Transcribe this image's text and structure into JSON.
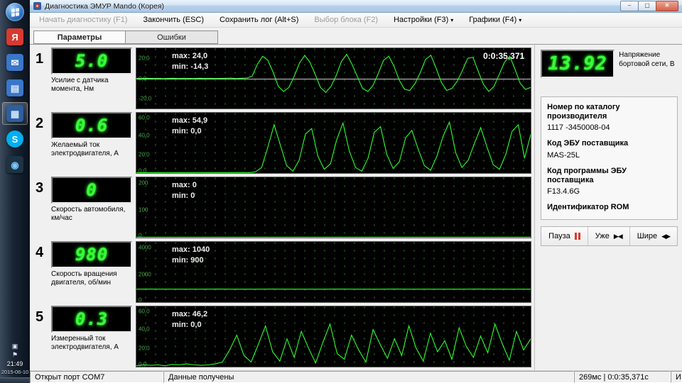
{
  "colors": {
    "trace": "#2eff2e",
    "led_green": "#39ff39",
    "grid_dot": "#1c451c",
    "pause_red": "#e0362c",
    "aero_blue": "#aac7e5"
  },
  "taskbar": {
    "clock_time": "21:49",
    "clock_date": "2015-06-10",
    "icons": [
      {
        "name": "yandex-browser",
        "glyph": "Я",
        "bg": "#d63a30",
        "fg": "#ffffff"
      },
      {
        "name": "mail-app",
        "glyph": "✉",
        "bg": "#3a76c9",
        "fg": "#ffffff"
      },
      {
        "name": "disk-app",
        "glyph": "▤",
        "bg": "#3a76c9",
        "fg": "#dce8f8"
      },
      {
        "name": "diagnostics-app",
        "glyph": "▦",
        "bg": "#2d5f9f",
        "fg": "#cfe3ff",
        "active": true
      },
      {
        "name": "skype",
        "glyph": "S",
        "bg": "#00aff0",
        "fg": "#ffffff",
        "round": true
      },
      {
        "name": "browser-globe",
        "glyph": "◉",
        "bg": "#1d3344",
        "fg": "#7fc7ff"
      }
    ]
  },
  "window": {
    "title": "Диагностика ЭМУР Mando (Корея)",
    "caption_buttons": [
      {
        "name": "minimize-button",
        "glyph": "–"
      },
      {
        "name": "maximize-button",
        "glyph": "▢"
      },
      {
        "name": "close-button",
        "glyph": "✕",
        "close": true
      }
    ],
    "menu": [
      {
        "id": "start-diagnostics",
        "label": "Начать диагностику (F1)",
        "disabled": true
      },
      {
        "id": "finish",
        "label": "Закончить (ESC)"
      },
      {
        "id": "save-log",
        "label": "Сохранить лог (Alt+S)"
      },
      {
        "id": "select-block",
        "label": "Выбор блока (F2)",
        "disabled": true
      },
      {
        "id": "settings",
        "label": "Настройки (F3)",
        "caret": true
      },
      {
        "id": "graphs",
        "label": "Графики (F4)",
        "caret": true
      }
    ],
    "tabs": [
      {
        "id": "parameters",
        "label": "Параметры",
        "active": true
      },
      {
        "id": "errors",
        "label": "Ошибки"
      }
    ]
  },
  "parameters": [
    {
      "index": "1",
      "value": "5.0",
      "label": "Усилие с датчика момента, Нм",
      "max": "max: 24,0",
      "min": "min: -14,3",
      "time": "0:0:35,371",
      "ylim": [
        -30,
        30
      ],
      "zeroline": 50,
      "axis": [
        {
          "t": "20,0",
          "p": 17
        },
        {
          "t": "0,0",
          "p": 50
        },
        {
          "t": "-20,0",
          "p": 83
        }
      ],
      "trace": [
        0.2,
        -0.1,
        0.1,
        0,
        0.2,
        -0.2,
        0,
        0.1,
        -0.1,
        0.2,
        0,
        -0.1,
        0.1,
        0,
        0.2,
        -0.1,
        0,
        0.1,
        0.3,
        -0.2,
        0.1,
        0.4,
        2,
        14,
        22,
        18,
        6,
        -8,
        -13,
        -9,
        2,
        15,
        23,
        16,
        4,
        -9,
        -14,
        -8,
        3,
        17,
        24,
        14,
        2,
        -10,
        -13,
        -7,
        5,
        18,
        22,
        12,
        -2,
        -11,
        -12,
        -5,
        6,
        19,
        23,
        10,
        -4,
        -12,
        -10,
        -3,
        8,
        20,
        21,
        7,
        -6,
        -13,
        -8,
        4,
        16,
        22,
        9,
        -5,
        -11,
        -9
      ]
    },
    {
      "index": "2",
      "value": "0.6",
      "label": "Желаемый ток электродвигателя, А",
      "max": "max: 54,9",
      "min": "min: 0,0",
      "ylim": [
        0,
        65
      ],
      "axis": [
        {
          "t": "60,0",
          "p": 8
        },
        {
          "t": "40,0",
          "p": 38
        },
        {
          "t": "20,0",
          "p": 69
        },
        {
          "t": "0,0",
          "p": 96
        }
      ],
      "trace": [
        0.3,
        0.2,
        0.4,
        0.3,
        0.2,
        0.5,
        0.3,
        0.4,
        0.2,
        0.3,
        0.5,
        0.4,
        0.3,
        0.2,
        0.4,
        0.3,
        0.5,
        0.6,
        0.4,
        1.2,
        6,
        28,
        52,
        30,
        8,
        2,
        14,
        42,
        48,
        18,
        4,
        10,
        36,
        54,
        24,
        6,
        2,
        16,
        44,
        50,
        20,
        5,
        12,
        38,
        46,
        26,
        8,
        3,
        18,
        40,
        55,
        22,
        6,
        14,
        32,
        49,
        28,
        9,
        4,
        20,
        45,
        52,
        16,
        42
      ]
    },
    {
      "index": "3",
      "value": "0",
      "label": "Скорость автомобиля, км/час",
      "max": "max: 0",
      "min": "min: 0",
      "ylim": [
        0,
        220
      ],
      "axis": [
        {
          "t": "200",
          "p": 9
        },
        {
          "t": "100",
          "p": 54
        },
        {
          "t": "0",
          "p": 96
        }
      ],
      "trace": [
        0,
        0,
        0,
        0,
        0,
        0,
        0,
        0,
        0,
        0,
        0,
        0,
        0
      ]
    },
    {
      "index": "4",
      "value": "980",
      "label": "Скорость вращения двигателя, об/мин",
      "max": "max: 1040",
      "min": "min: 900",
      "ylim": [
        0,
        4400
      ],
      "axis": [
        {
          "t": "4000",
          "p": 9
        },
        {
          "t": "2000",
          "p": 54
        },
        {
          "t": "0",
          "p": 96
        }
      ],
      "trace": [
        950,
        955,
        948,
        952,
        950,
        946,
        953,
        949,
        951,
        947,
        954,
        950,
        948,
        952,
        949,
        955,
        951,
        947,
        950,
        953,
        948,
        951,
        946,
        952,
        950,
        954,
        949,
        947,
        951,
        950
      ]
    },
    {
      "index": "5",
      "value": "0.3",
      "label": "Измеренный ток электродвигателя, А",
      "max": "max: 46,2",
      "min": "min: 0,0",
      "ylim": [
        0,
        65
      ],
      "axis": [
        {
          "t": "60,0",
          "p": 8
        },
        {
          "t": "40,0",
          "p": 38
        },
        {
          "t": "20,0",
          "p": 69
        },
        {
          "t": "0,0",
          "p": 96
        }
      ],
      "trace": [
        1,
        2,
        1.5,
        2,
        1,
        2.5,
        2,
        3,
        2,
        1.5,
        2,
        3,
        5,
        18,
        34,
        12,
        5,
        24,
        44,
        16,
        6,
        30,
        10,
        38,
        20,
        4,
        26,
        46,
        14,
        8,
        34,
        18,
        5,
        40,
        24,
        9,
        30,
        12,
        44,
        20,
        6,
        36,
        16,
        28,
        8,
        42,
        22,
        10,
        33,
        15,
        46,
        25,
        7,
        38,
        18,
        30
      ]
    }
  ],
  "voltage": {
    "value": "13.92",
    "label": "Напряжение бортовой сети, В"
  },
  "info": [
    {
      "title": "Номер по каталогу производителя",
      "value": "1117 -3450008-04"
    },
    {
      "title": "Код ЭБУ поставщика",
      "value": "MAS-25L"
    },
    {
      "title": "Код программы ЭБУ поставщика",
      "value": "F13.4.6G"
    },
    {
      "title": "Идентификатор ROM",
      "value": ""
    }
  ],
  "controls": {
    "pause": "Пауза",
    "narrower": "Уже",
    "narrower_glyph": "▶◀",
    "wider": "Шире",
    "wider_glyph": "◀▶"
  },
  "statusbar": {
    "port": "Открыт порт COM7",
    "message": "Данные получены",
    "timing": "269мс | 0:0:35,371с",
    "extra": "И"
  }
}
